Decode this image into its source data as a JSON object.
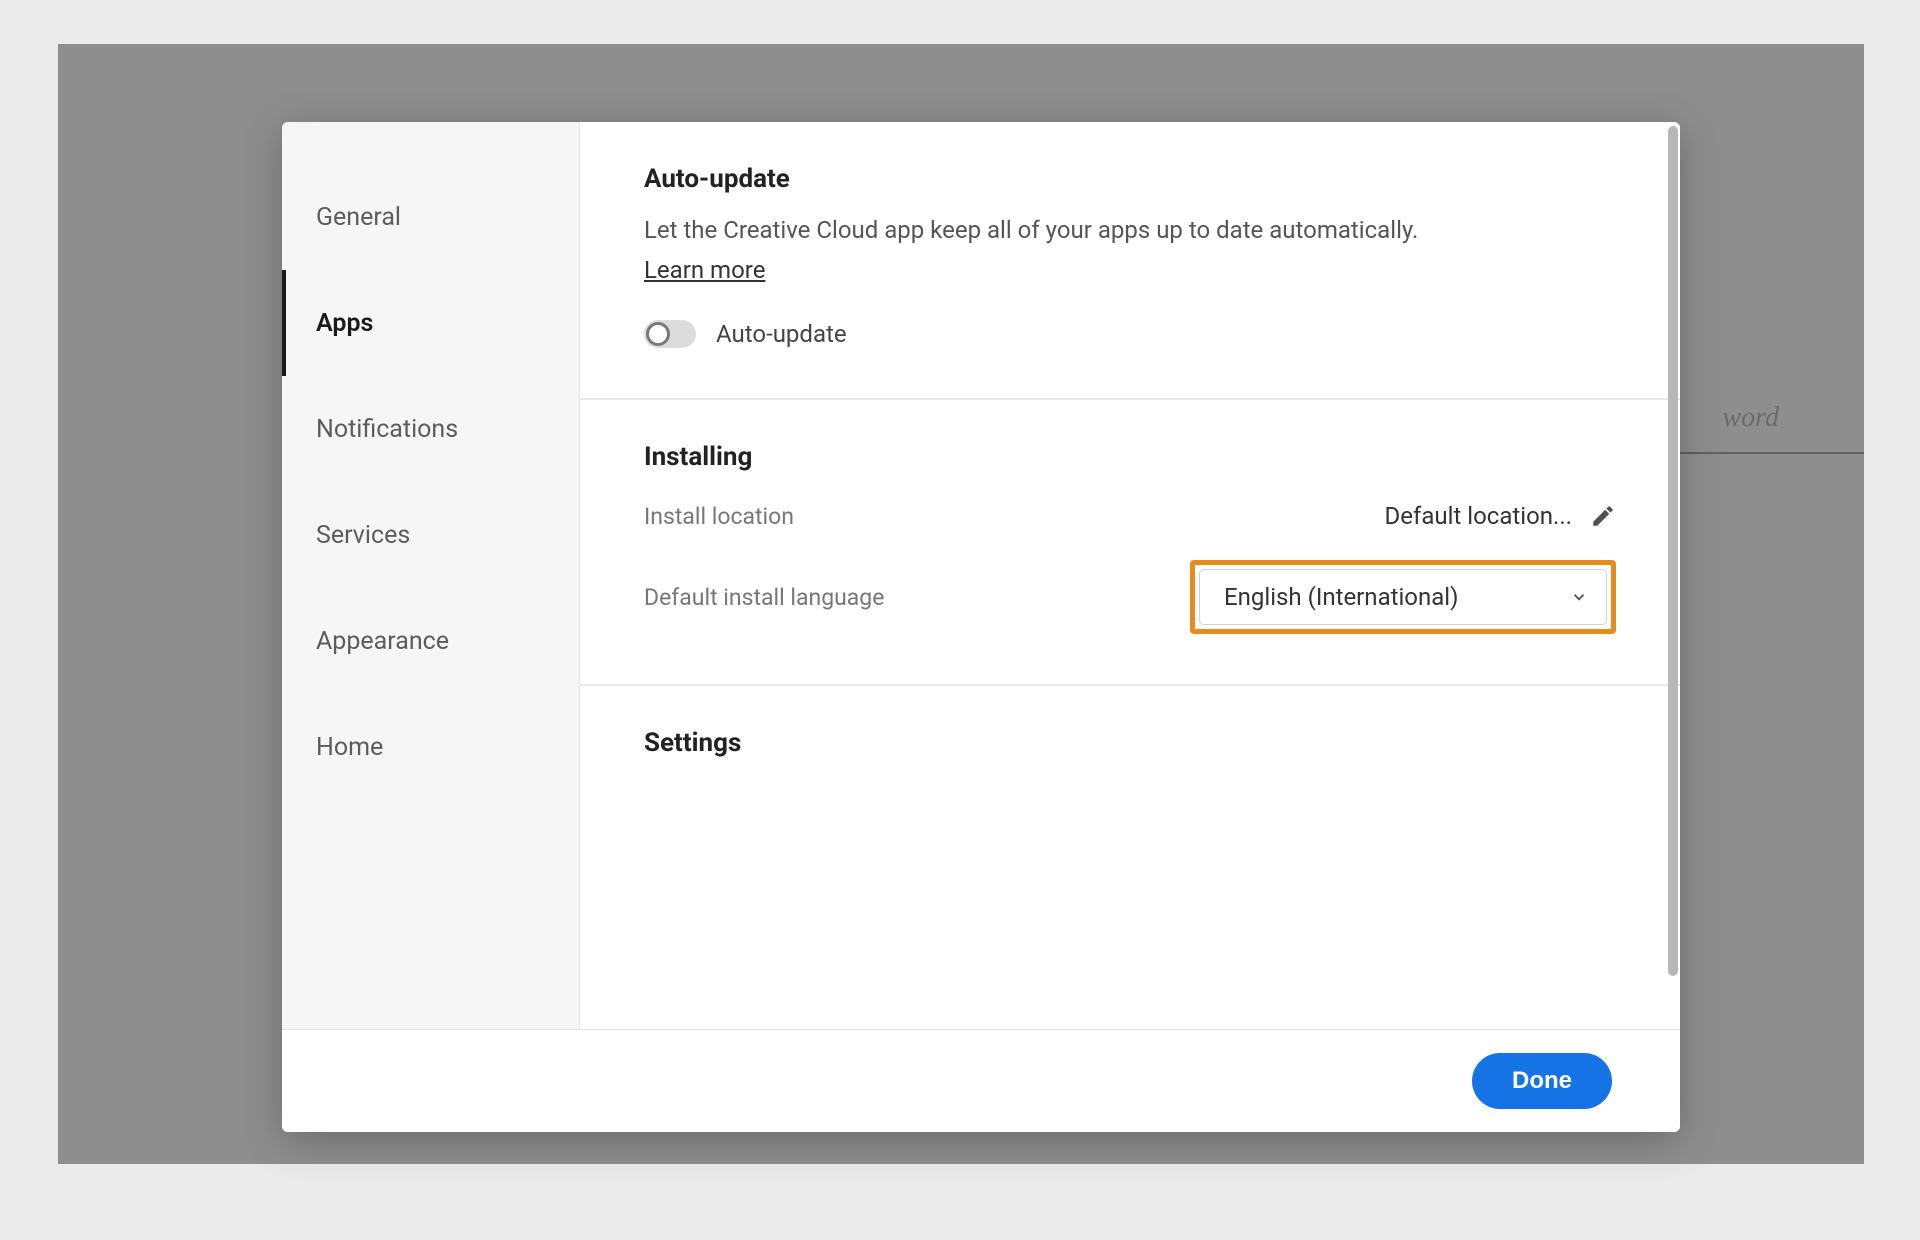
{
  "background": {
    "hint_text": "word"
  },
  "sidebar": {
    "items": [
      {
        "label": "General",
        "selected": false
      },
      {
        "label": "Apps",
        "selected": true
      },
      {
        "label": "Notifications",
        "selected": false
      },
      {
        "label": "Services",
        "selected": false
      },
      {
        "label": "Appearance",
        "selected": false
      },
      {
        "label": "Home",
        "selected": false
      }
    ]
  },
  "main": {
    "auto_update": {
      "heading": "Auto-update",
      "description": "Let the Creative Cloud app keep all of your apps up to date automatically.",
      "learn_more": "Learn more",
      "toggle_label": "Auto-update",
      "toggle_on": false
    },
    "installing": {
      "heading": "Installing",
      "location_label": "Install location",
      "location_value": "Default location...",
      "language_label": "Default install language",
      "language_value": "English (International)"
    },
    "settings": {
      "heading": "Settings"
    }
  },
  "footer": {
    "done": "Done"
  },
  "highlight_color": "#e78b1e"
}
